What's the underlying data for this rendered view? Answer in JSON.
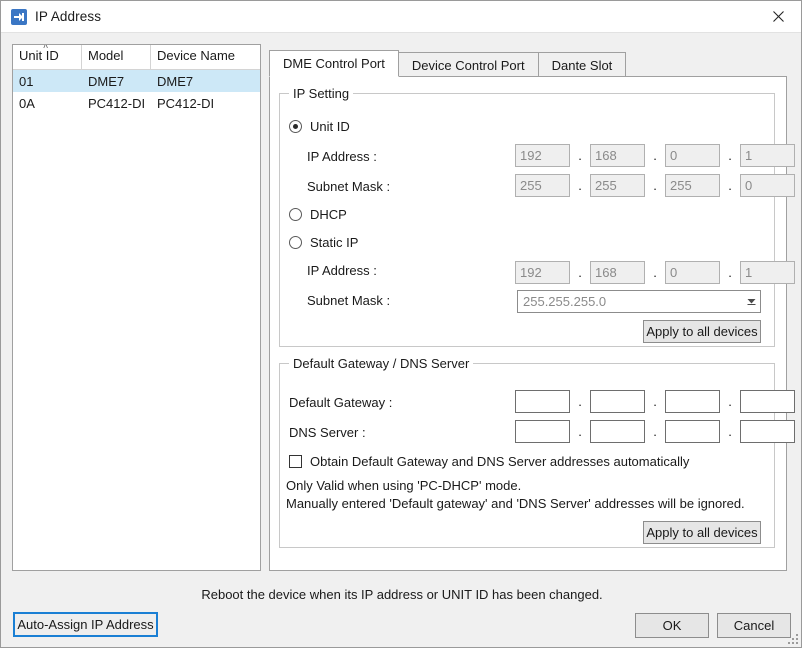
{
  "window": {
    "title": "IP Address",
    "icon": "ip-address-icon",
    "close_label": "✕"
  },
  "device_list": {
    "columns": [
      "Unit ID",
      "Model",
      "Device Name"
    ],
    "sort_indicator": "˄",
    "rows": [
      {
        "unit_id": "01",
        "model": "DME7",
        "device_name": "DME7",
        "selected": true
      },
      {
        "unit_id": "0A",
        "model": "PC412-DI",
        "device_name": "PC412-DI",
        "selected": false
      }
    ]
  },
  "tabs": [
    {
      "label": "DME Control Port",
      "active": true
    },
    {
      "label": "Device Control Port",
      "active": false
    },
    {
      "label": "Dante Slot",
      "active": false
    }
  ],
  "ip_setting": {
    "legend": "IP Setting",
    "modes": [
      {
        "label": "Unit ID",
        "selected": true
      },
      {
        "label": "DHCP",
        "selected": false
      },
      {
        "label": "Static IP",
        "selected": false
      }
    ],
    "unit_id_block": {
      "ip_label": "IP Address :",
      "ip_octets": [
        "192",
        "168",
        "0",
        "1"
      ],
      "mask_label": "Subnet Mask :",
      "mask_octets": [
        "255",
        "255",
        "255",
        "0"
      ],
      "enabled": false
    },
    "static_ip_block": {
      "ip_label": "IP Address :",
      "ip_octets": [
        "192",
        "168",
        "0",
        "1"
      ],
      "mask_label": "Subnet Mask :",
      "mask_value": "255.255.255.0",
      "enabled": false
    },
    "apply_button": "Apply to all devices"
  },
  "gateway_dns": {
    "legend": "Default Gateway / DNS Server",
    "gateway_label": "Default Gateway :",
    "gateway_octets": [
      "",
      "",
      "",
      ""
    ],
    "dns_label": "DNS Server :",
    "dns_octets": [
      "",
      "",
      "",
      ""
    ],
    "checkbox_label": "Obtain Default Gateway and DNS Server addresses automatically",
    "checkbox_checked": false,
    "info_line1": "Only Valid when using 'PC-DHCP' mode.",
    "info_line2": "Manually entered 'Default gateway' and 'DNS Server' addresses will be ignored.",
    "apply_button": "Apply to all devices"
  },
  "footer": {
    "reboot_note": "Reboot the device when its IP address or UNIT ID has been changed.",
    "auto_assign_button": "Auto-Assign IP Address",
    "ok_button": "OK",
    "cancel_button": "Cancel"
  },
  "separator": ".",
  "colors": {
    "accent": "#3a76c4",
    "selection": "#cde8f7",
    "focus_ring": "#1a7fd4",
    "window_bg": "#f0f0f0"
  }
}
